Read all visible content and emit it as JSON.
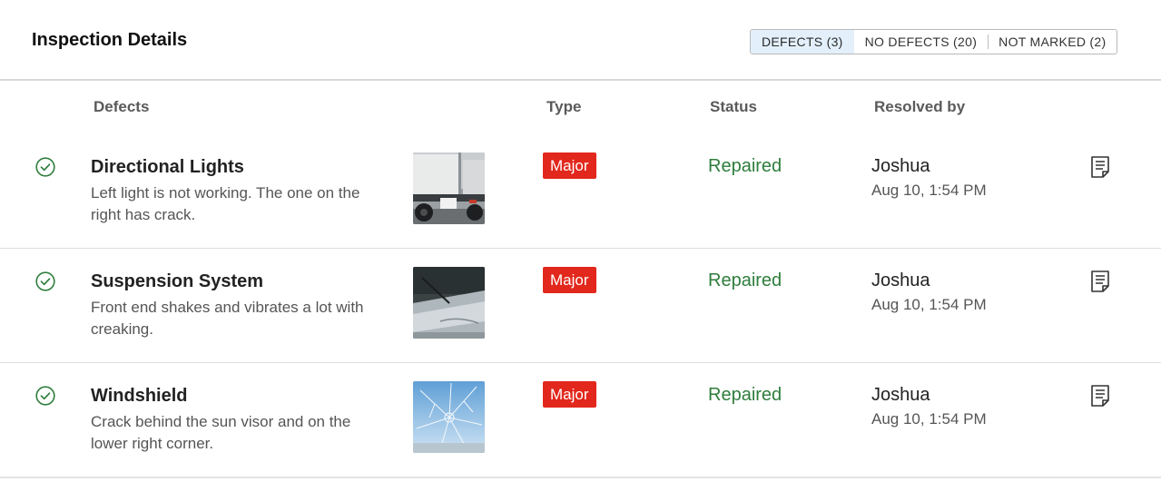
{
  "header": {
    "title": "Inspection Details",
    "filters": [
      {
        "label": "DEFECTS (3)",
        "active": true
      },
      {
        "label": "NO DEFECTS (20)",
        "active": false
      },
      {
        "label": "NOT MARKED (2)",
        "active": false
      }
    ]
  },
  "table": {
    "columns": {
      "defects": "Defects",
      "type": "Type",
      "status": "Status",
      "resolved_by": "Resolved by"
    },
    "rows": [
      {
        "name": "Directional Lights",
        "description": "Left light is not working. The one on the right has crack.",
        "type": "Major",
        "status": "Repaired",
        "resolved_by": "Joshua",
        "resolved_at": "Aug 10, 1:54 PM",
        "check_icon": "check-circle-icon",
        "note_icon": "document-icon"
      },
      {
        "name": "Suspension System",
        "description": "Front end shakes and vibrates a lot with creaking.",
        "type": "Major",
        "status": "Repaired",
        "resolved_by": "Joshua",
        "resolved_at": "Aug 10, 1:54 PM",
        "check_icon": "check-circle-icon",
        "note_icon": "document-icon"
      },
      {
        "name": "Windshield",
        "description": "Crack behind the sun visor and on the lower right corner.",
        "type": "Major",
        "status": "Repaired",
        "resolved_by": "Joshua",
        "resolved_at": "Aug 10, 1:54 PM",
        "check_icon": "check-circle-icon",
        "note_icon": "document-icon"
      }
    ]
  },
  "colors": {
    "status_green": "#2e7d3c",
    "badge_red": "#e2271c",
    "active_filter_bg": "#e3f0fb"
  }
}
